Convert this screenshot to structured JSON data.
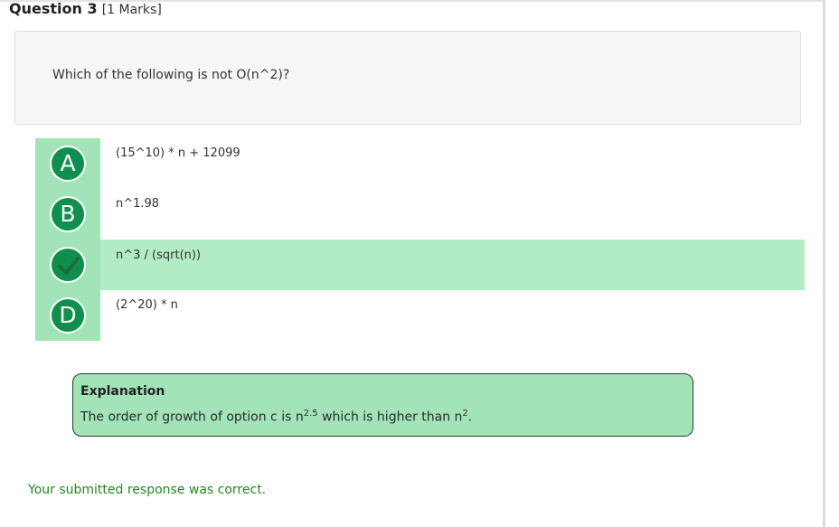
{
  "question": {
    "title": "Question 3",
    "marks": "[1 Marks]",
    "text": "Which of the following is not O(n^2)?"
  },
  "options": [
    {
      "letter": "A",
      "text": "(15^10) * n + 12099",
      "state": "unselected"
    },
    {
      "letter": "B",
      "text": "n^1.98",
      "state": "unselected"
    },
    {
      "letter": "C",
      "text": "n^3 / (sqrt(n))",
      "state": "correct",
      "icon": "checkmark-icon"
    },
    {
      "letter": "D",
      "text": "(2^20) * n",
      "state": "unselected"
    }
  ],
  "explanation": {
    "title": "Explanation",
    "prefix": "The order of growth of option c is n",
    "exp1": "2.5",
    "middle": " which is higher than n",
    "exp2": "2",
    "suffix": "."
  },
  "feedback": "Your submitted response was correct.",
  "colors": {
    "badge": "#0f8f4e",
    "option_rail": "#a2e4b8",
    "correct_row": "#b1ecc4",
    "explanation_bg": "#a2e4b8",
    "feedback_text": "#1f8a1f",
    "checkmark": "#1f6b34"
  }
}
